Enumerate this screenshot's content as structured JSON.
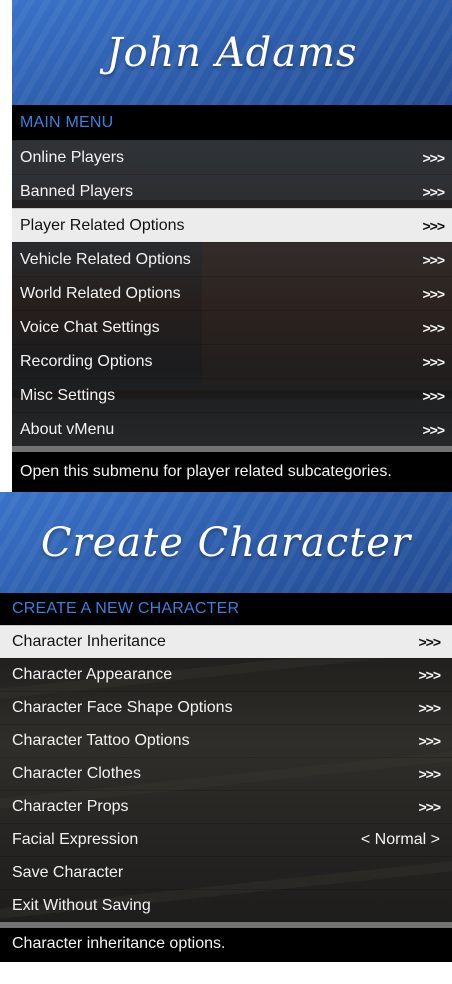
{
  "menu1": {
    "title": "John Adams",
    "subtitle": "MAIN MENU",
    "items": [
      {
        "label": "Online Players",
        "right": ">>>"
      },
      {
        "label": "Banned Players",
        "right": ">>>"
      },
      {
        "label": "Player Related Options",
        "right": ">>>"
      },
      {
        "label": "Vehicle Related Options",
        "right": ">>>"
      },
      {
        "label": "World Related Options",
        "right": ">>>"
      },
      {
        "label": "Voice Chat Settings",
        "right": ">>>"
      },
      {
        "label": "Recording Options",
        "right": ">>>"
      },
      {
        "label": "Misc Settings",
        "right": ">>>"
      },
      {
        "label": "About vMenu",
        "right": ">>>"
      }
    ],
    "description": "Open this submenu for player related subcategories."
  },
  "menu2": {
    "title": "Create Character",
    "subtitle": "CREATE A NEW CHARACTER",
    "items": [
      {
        "label": "Character Inheritance",
        "right": ">>>"
      },
      {
        "label": "Character Appearance",
        "right": ">>>"
      },
      {
        "label": "Character Face Shape Options",
        "right": ">>>"
      },
      {
        "label": "Character Tattoo Options",
        "right": ">>>"
      },
      {
        "label": "Character Clothes",
        "right": ">>>"
      },
      {
        "label": "Character Props",
        "right": ">>>"
      },
      {
        "label": "Facial Expression",
        "right": "< Normal >"
      },
      {
        "label": "Save Character",
        "right": ""
      },
      {
        "label": "Exit Without Saving",
        "right": ""
      }
    ],
    "description": "Character inheritance options."
  }
}
